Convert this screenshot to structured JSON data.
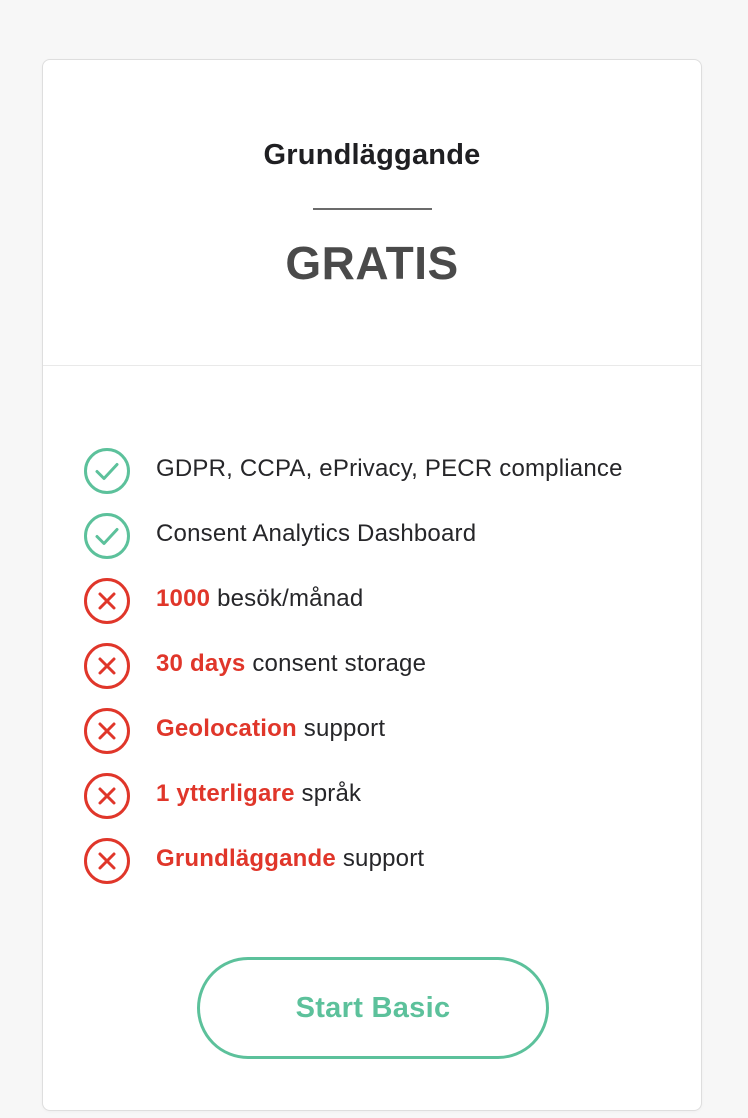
{
  "plan": {
    "name": "Grundläggande",
    "price": "GRATIS"
  },
  "colors": {
    "check": "#5cc19b",
    "cross": "#e0362a",
    "button": "#5cc19b"
  },
  "features": [
    {
      "icon": "check-circle-icon",
      "highlight": "",
      "text": "GDPR, CCPA, ePrivacy, PECR compliance"
    },
    {
      "icon": "check-circle-icon",
      "highlight": "",
      "text": "Consent Analytics Dashboard"
    },
    {
      "icon": "x-circle-icon",
      "highlight": "1000",
      "text": " besök/månad"
    },
    {
      "icon": "x-circle-icon",
      "highlight": "30 days",
      "text": " consent storage"
    },
    {
      "icon": "x-circle-icon",
      "highlight": "Geolocation",
      "text": " support"
    },
    {
      "icon": "x-circle-icon",
      "highlight": "1 ytterligare",
      "text": " språk"
    },
    {
      "icon": "x-circle-icon",
      "highlight": "Grundläggande",
      "text": " support"
    }
  ],
  "cta": {
    "label": "Start Basic"
  }
}
